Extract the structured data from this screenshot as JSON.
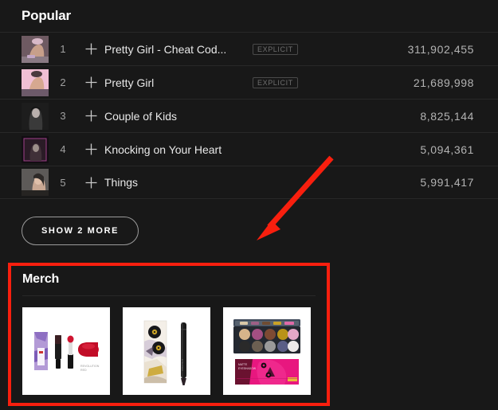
{
  "theme": {
    "background": "#181818",
    "text_primary": "#ffffff",
    "text_secondary": "#b3b3b3",
    "annotation_red": "#f81f0e",
    "divider": "#282828"
  },
  "popular": {
    "title": "Popular",
    "add_icon": "plus-icon",
    "explicit_label": "EXPLICIT",
    "tracks": [
      {
        "number": "1",
        "title": "Pretty Girl - Cheat Cod...",
        "explicit": true,
        "plays": "311,902,455",
        "art": "art-pretty-girl-cheat-codes"
      },
      {
        "number": "2",
        "title": "Pretty Girl",
        "explicit": true,
        "plays": "21,689,998",
        "art": "art-pretty-girl"
      },
      {
        "number": "3",
        "title": "Couple of Kids",
        "explicit": false,
        "plays": "8,825,144",
        "art": "art-couple-of-kids"
      },
      {
        "number": "4",
        "title": "Knocking on Your Heart",
        "explicit": false,
        "plays": "5,094,361",
        "art": "art-knocking-on-your-heart"
      },
      {
        "number": "5",
        "title": "Things",
        "explicit": false,
        "plays": "5,991,417",
        "art": "art-things"
      }
    ],
    "show_more_label": "SHOW 2 MORE"
  },
  "merch": {
    "title": "Merch",
    "items": [
      {
        "name": "lipstick-set-product",
        "alt": "Liquid lipstick and red lipstick bullet set"
      },
      {
        "name": "eyeliner-pencil-product",
        "alt": "Patterned box with black eyeliner pencil"
      },
      {
        "name": "eyeshadow-palette-product",
        "alt": "Twelve-pan eyeshadow palette with pink packaging"
      }
    ]
  },
  "annotations": {
    "highlight_box": "merch-section-highlight",
    "arrow": "arrow-pointing-to-merch"
  }
}
